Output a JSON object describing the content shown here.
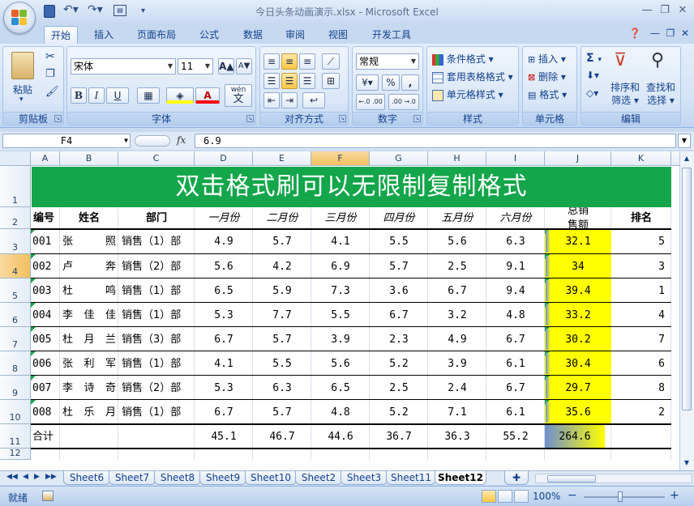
{
  "window": {
    "title": "今日头条动画演示.xlsx - Microsoft Excel"
  },
  "ribbon": {
    "tabs": [
      "开始",
      "插入",
      "页面布局",
      "公式",
      "数据",
      "审阅",
      "视图",
      "开发工具"
    ],
    "clipboard": {
      "paste_label": "粘贴",
      "group": "剪贴板"
    },
    "font": {
      "name": "宋体",
      "size": "11",
      "group": "字体",
      "bold": "B",
      "italic": "I",
      "underline": "U",
      "wen": "wén",
      "wen_char": "文"
    },
    "align": {
      "group": "对齐方式"
    },
    "number": {
      "format": "常规",
      "group": "数字",
      "percent": "%",
      "comma": ",",
      "dec_inc": "←.0 .00",
      "dec_dec": ".00 →.0"
    },
    "styles": {
      "cond": "条件格式",
      "table": "套用表格格式",
      "cell": "单元格样式",
      "group": "样式"
    },
    "cells": {
      "insert": "插入",
      "delete": "删除",
      "format": "格式",
      "group": "单元格"
    },
    "editing": {
      "sort": "排序和",
      "sort2": "筛选",
      "find": "查找和",
      "find2": "选择",
      "group": "编辑",
      "sigma": "Σ"
    }
  },
  "formula_bar": {
    "name_box": "F4",
    "fx": "fx",
    "value": "6.9"
  },
  "columns": [
    "A",
    "B",
    "C",
    "D",
    "E",
    "F",
    "G",
    "H",
    "I",
    "J",
    "K"
  ],
  "rows": [
    "1",
    "2",
    "3",
    "4",
    "5",
    "6",
    "7",
    "8",
    "9",
    "10",
    "11",
    "12"
  ],
  "sheet": {
    "banner": "双击格式刷可以无限制复制格式",
    "headers": [
      "编号",
      "姓名",
      "部门",
      "一月份",
      "二月份",
      "三月份",
      "四月份",
      "五月份",
      "六月份",
      "总销",
      "售额",
      "排名"
    ],
    "records": [
      {
        "id": "001",
        "name1": "张",
        "name2": "",
        "name3": "照",
        "dept": "销售（1）部",
        "m": [
          "4.9",
          "5.7",
          "4.1",
          "5.5",
          "5.6",
          "6.3"
        ],
        "total": "32.1",
        "rank": "5"
      },
      {
        "id": "002",
        "name1": "卢",
        "name2": "",
        "name3": "奔",
        "dept": "销售（2）部",
        "m": [
          "5.6",
          "4.2",
          "6.9",
          "5.7",
          "2.5",
          "9.1"
        ],
        "total": "34",
        "rank": "3"
      },
      {
        "id": "003",
        "name1": "杜",
        "name2": "",
        "name3": "鸣",
        "dept": "销售（1）部",
        "m": [
          "6.5",
          "5.9",
          "7.3",
          "3.6",
          "6.7",
          "9.4"
        ],
        "total": "39.4",
        "rank": "1"
      },
      {
        "id": "004",
        "name1": "李",
        "name2": "佳",
        "name3": "佳",
        "dept": "销售（1）部",
        "m": [
          "5.3",
          "7.7",
          "5.5",
          "6.7",
          "3.2",
          "4.8"
        ],
        "total": "33.2",
        "rank": "4"
      },
      {
        "id": "005",
        "name1": "杜",
        "name2": "月",
        "name3": "兰",
        "dept": "销售（3）部",
        "m": [
          "6.7",
          "5.7",
          "3.9",
          "2.3",
          "4.9",
          "6.7"
        ],
        "total": "30.2",
        "rank": "7"
      },
      {
        "id": "006",
        "name1": "张",
        "name2": "利",
        "name3": "军",
        "dept": "销售（1）部",
        "m": [
          "4.1",
          "5.5",
          "5.6",
          "5.2",
          "3.9",
          "6.1"
        ],
        "total": "30.4",
        "rank": "6"
      },
      {
        "id": "007",
        "name1": "李",
        "name2": "诗",
        "name3": "奇",
        "dept": "销售（2）部",
        "m": [
          "5.3",
          "6.3",
          "6.5",
          "2.5",
          "2.4",
          "6.7"
        ],
        "total": "29.7",
        "rank": "8"
      },
      {
        "id": "008",
        "name1": "杜",
        "name2": "乐",
        "name3": "月",
        "dept": "销售（1）部",
        "m": [
          "6.7",
          "5.7",
          "4.8",
          "5.2",
          "7.1",
          "6.1"
        ],
        "total": "35.6",
        "rank": "2"
      }
    ],
    "totals": {
      "label": "合计",
      "m": [
        "45.1",
        "46.7",
        "44.6",
        "36.7",
        "36.3",
        "55.2"
      ],
      "total": "264.6"
    }
  },
  "sheet_tabs": [
    "Sheet6",
    "Sheet7",
    "Sheet8",
    "Sheet9",
    "Sheet10",
    "Sheet2",
    "Sheet3",
    "Sheet11",
    "Sheet12"
  ],
  "active_sheet": "Sheet12",
  "status": {
    "ready": "就绪",
    "zoom": "100%",
    "minus": "−",
    "plus": "+"
  },
  "colors": {
    "banner": "#13a64a",
    "highlight": "#ffff00",
    "ribbon_text": "#15428b"
  }
}
